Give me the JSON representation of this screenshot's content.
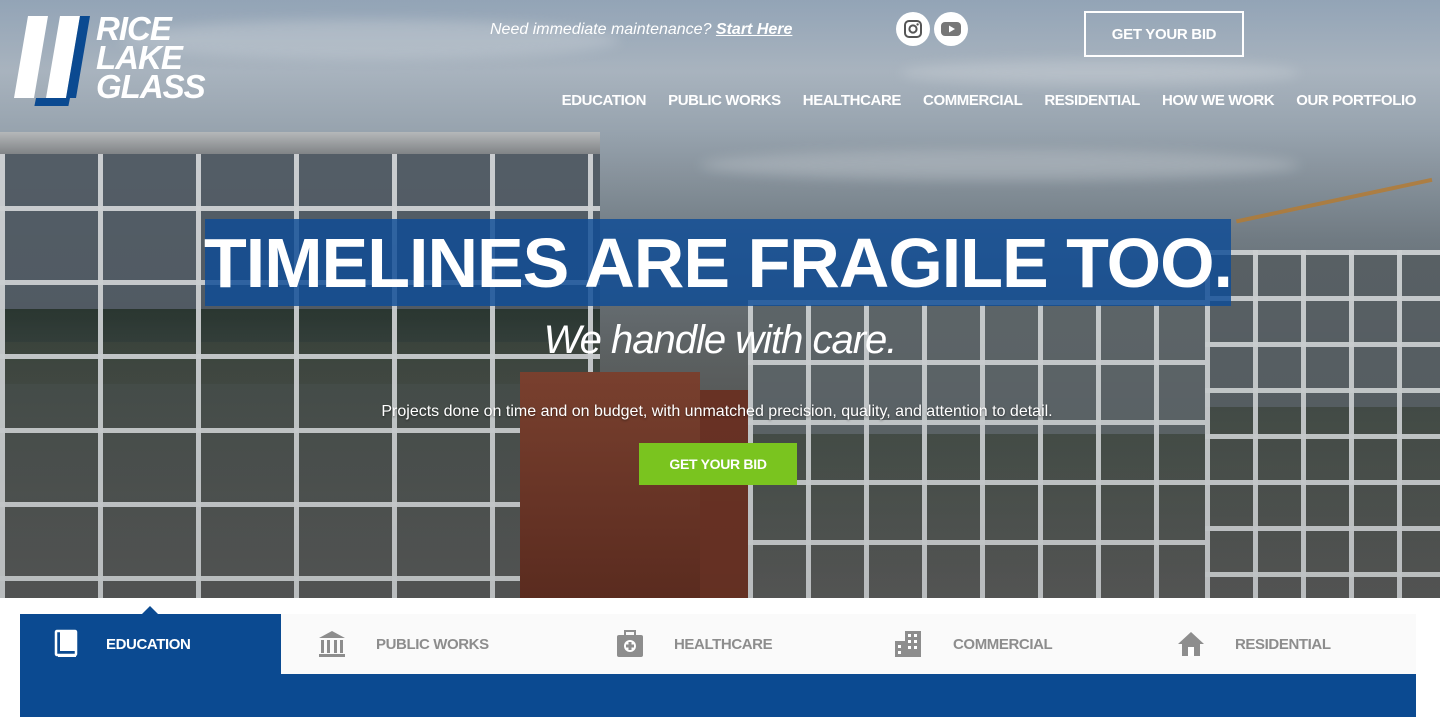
{
  "brand": {
    "logo_lines": [
      "RICE",
      "LAKE",
      "GLASS"
    ]
  },
  "header": {
    "maintenance_text": "Need immediate maintenance?",
    "maintenance_link": "Start Here",
    "social": [
      {
        "name": "instagram-icon"
      },
      {
        "name": "youtube-icon"
      }
    ],
    "bid_label": "GET YOUR BID"
  },
  "nav": {
    "items": [
      {
        "label": "EDUCATION"
      },
      {
        "label": "PUBLIC WORKS"
      },
      {
        "label": "HEALTHCARE"
      },
      {
        "label": "COMMERCIAL"
      },
      {
        "label": "RESIDENTIAL"
      },
      {
        "label": "HOW WE WORK"
      },
      {
        "label": "OUR PORTFOLIO"
      }
    ]
  },
  "hero": {
    "headline": "TIMELINES ARE FRAGILE TOO.",
    "subheadline": "We handle with care.",
    "description": "Projects done on time and on budget, with unmatched precision, quality, and attention to detail.",
    "cta_label": "GET YOUR BID"
  },
  "tabs": {
    "items": [
      {
        "label": "EDUCATION",
        "icon": "book-icon",
        "active": true
      },
      {
        "label": "PUBLIC WORKS",
        "icon": "bank-icon",
        "active": false
      },
      {
        "label": "HEALTHCARE",
        "icon": "medical-kit-icon",
        "active": false
      },
      {
        "label": "COMMERCIAL",
        "icon": "office-building-icon",
        "active": false
      },
      {
        "label": "RESIDENTIAL",
        "icon": "house-icon",
        "active": false
      }
    ]
  },
  "colors": {
    "brand_blue": "#0b4a91",
    "cta_green": "#7ac41f",
    "inactive_tab_text": "#8d8d8d"
  }
}
